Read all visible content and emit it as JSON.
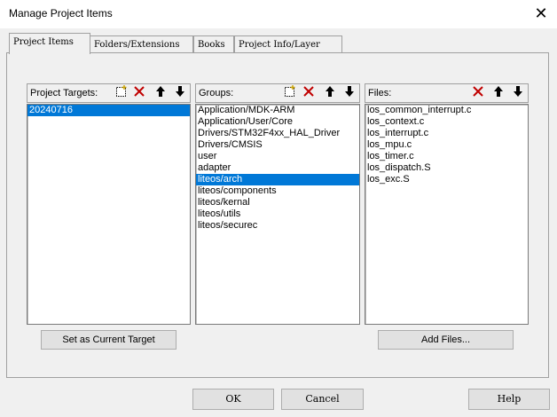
{
  "window": {
    "title": "Manage Project Items",
    "close_glyph": "✕"
  },
  "tabs": [
    {
      "label": "Project Items",
      "active": true
    },
    {
      "label": "Folders/Extensions",
      "active": false
    },
    {
      "label": "Books",
      "active": false
    },
    {
      "label": "Project Info/Layer",
      "active": false
    }
  ],
  "targets": {
    "label": "Project Targets:",
    "items": [
      "20240716"
    ],
    "selected": "20240716"
  },
  "groups": {
    "label": "Groups:",
    "items": [
      "Application/MDK-ARM",
      "Application/User/Core",
      "Drivers/STM32F4xx_HAL_Driver",
      "Drivers/CMSIS",
      "user",
      "adapter",
      "liteos/arch",
      "liteos/components",
      "liteos/kernal",
      "liteos/utils",
      "liteos/securec"
    ],
    "selected": "liteos/arch"
  },
  "files": {
    "label": "Files:",
    "items": [
      "los_common_interrupt.c",
      "los_context.c",
      "los_interrupt.c",
      "los_mpu.c",
      "los_timer.c",
      "los_dispatch.S",
      "los_exc.S"
    ]
  },
  "icons": {
    "new": "new-icon",
    "delete": "delete-icon",
    "move_up": "arrow-up-icon",
    "move_down": "arrow-down-icon",
    "delete_color": "#c00000"
  },
  "buttons": {
    "set_current_target": "Set as Current Target",
    "add_files": "Add Files...",
    "ok": "OK",
    "cancel": "Cancel",
    "help": "Help"
  }
}
